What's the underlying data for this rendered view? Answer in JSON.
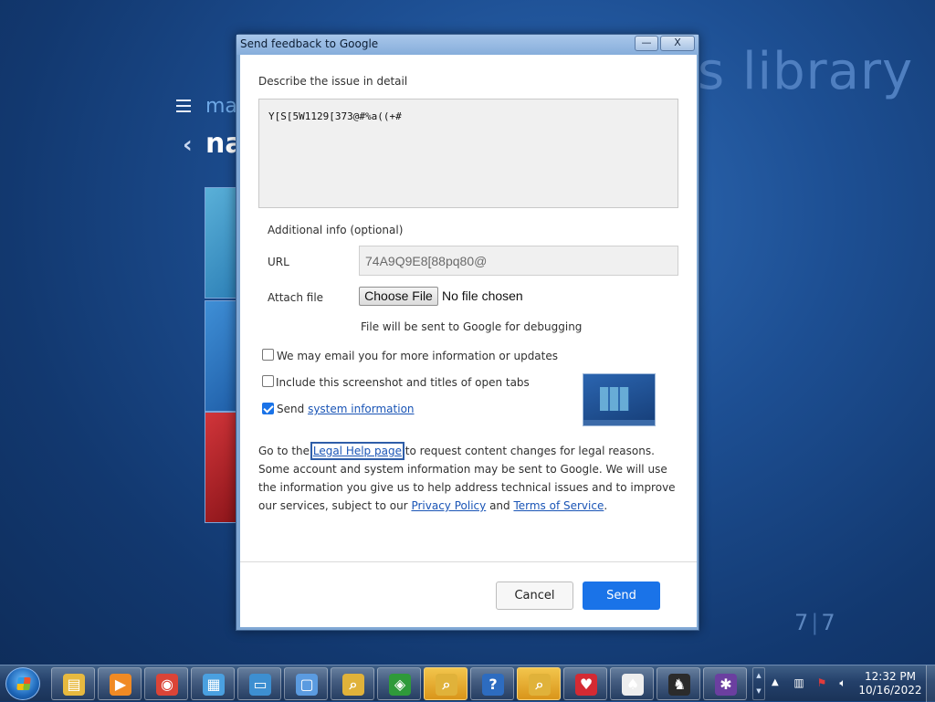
{
  "background": {
    "heading": "s library",
    "subtitle": "ma",
    "title": "na",
    "page_current": "7",
    "page_total": "7"
  },
  "dialog": {
    "title": "Send feedback to Google",
    "describe_label": "Describe the issue in detail",
    "description_value": "Y[S[5W1129[373@#%a((+#",
    "additional_info_label": "Additional info (optional)",
    "url_label": "URL",
    "url_value": "74A9Q9E8[88pq80@",
    "attach_label": "Attach file",
    "choose_file_label": "Choose File",
    "no_file_text": "No file chosen",
    "file_note": "File will be sent to Google for debugging",
    "email_option": {
      "label": "We may email you for more information or updates",
      "checked": false
    },
    "screenshot_option": {
      "label": "Include this screenshot and titles of open tabs",
      "checked": false
    },
    "sysinfo_option": {
      "prefix": "Send",
      "link": "system information",
      "checked": true
    },
    "legal": {
      "t1": "Go to the",
      "legal_link": "Legal Help page",
      "t2": "to request content changes for legal reasons. Some account and system information may be sent to Google. We will use the information you give us to help address technical issues and to improve our services, subject to our",
      "privacy_link": "Privacy Policy",
      "t3": "and",
      "terms_link": "Terms of Service",
      "t4": "."
    },
    "cancel_label": "Cancel",
    "send_label": "Send",
    "minimize_glyph": "—",
    "close_glyph": "X"
  },
  "taskbar": {
    "apps": [
      {
        "name": "explorer",
        "icon": "folder-icon",
        "glyph": "▤",
        "color": "#e7b93f"
      },
      {
        "name": "media-player",
        "icon": "media-player-icon",
        "glyph": "▶",
        "color": "#f08a24"
      },
      {
        "name": "chrome",
        "icon": "chrome-icon",
        "glyph": "◉",
        "color": "#db4437"
      },
      {
        "name": "control-panel",
        "icon": "control-panel-icon",
        "glyph": "▦",
        "color": "#4aa0e0"
      },
      {
        "name": "remote-desktop",
        "icon": "monitor-icon",
        "glyph": "▭",
        "color": "#3d8fd1"
      },
      {
        "name": "window-app",
        "icon": "window-icon",
        "glyph": "▢",
        "color": "#5b9be0"
      },
      {
        "name": "search-folder",
        "icon": "search-icon",
        "glyph": "⌕",
        "color": "#e0b23a"
      },
      {
        "name": "windows-logo",
        "icon": "windows-logo-icon",
        "glyph": "◈",
        "color": "#2f9a3a"
      },
      {
        "name": "search-folder-2",
        "icon": "search-icon",
        "glyph": "⌕",
        "color": "#e0b23a",
        "active": true
      },
      {
        "name": "help",
        "icon": "help-icon",
        "glyph": "?",
        "color": "#2d6cc0"
      },
      {
        "name": "search-folder-3",
        "icon": "search-icon",
        "glyph": "⌕",
        "color": "#e0b23a",
        "active": true
      },
      {
        "name": "hearts",
        "icon": "hearts-game-icon",
        "glyph": "♥",
        "color": "#d42a33"
      },
      {
        "name": "solitaire",
        "icon": "cards-icon",
        "glyph": "♠",
        "color": "#eeeeee"
      },
      {
        "name": "chess",
        "icon": "chess-icon",
        "glyph": "♞",
        "color": "#2b2b2b"
      },
      {
        "name": "spider",
        "icon": "spider-icon",
        "glyph": "✱",
        "color": "#6b3fa0"
      }
    ],
    "time": "12:32 PM",
    "date": "10/16/2022"
  }
}
